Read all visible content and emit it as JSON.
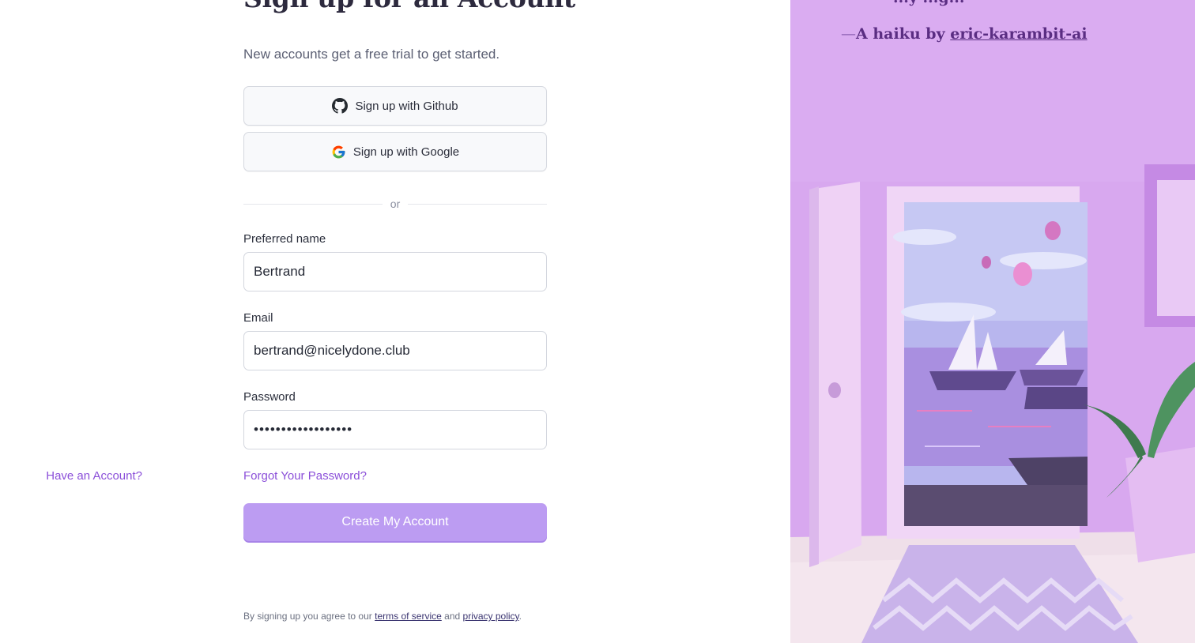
{
  "form": {
    "title": "Sign up for an Account",
    "subtitle": "New accounts get a free trial to get started.",
    "github_label": "Sign up with Github",
    "google_label": "Sign up with Google",
    "divider_text": "or",
    "name_label": "Preferred name",
    "name_value": "Bertrand",
    "email_label": "Email",
    "email_value": "bertrand@nicelydone.club",
    "password_label": "Password",
    "password_value": "••••••••••••••••••",
    "forgot_link": "Forgot Your Password?",
    "have_account_link": "Have an Account?",
    "submit_label": "Create My Account",
    "legal_prefix": "By signing up you agree to our",
    "terms_link": "terms of service",
    "legal_and": "and",
    "privacy_link": "privacy policy",
    "legal_suffix": "."
  },
  "art": {
    "haiku_top": "...y ...g...",
    "haiku_prefix": "A haiku by",
    "haiku_author": "eric-karambit-ai"
  },
  "colors": {
    "accent": "#8b4fd9",
    "primary_button": "#bc9cf2",
    "art_background": "#d7a6ee"
  },
  "icons": {
    "github": "github-icon",
    "google": "google-icon"
  }
}
